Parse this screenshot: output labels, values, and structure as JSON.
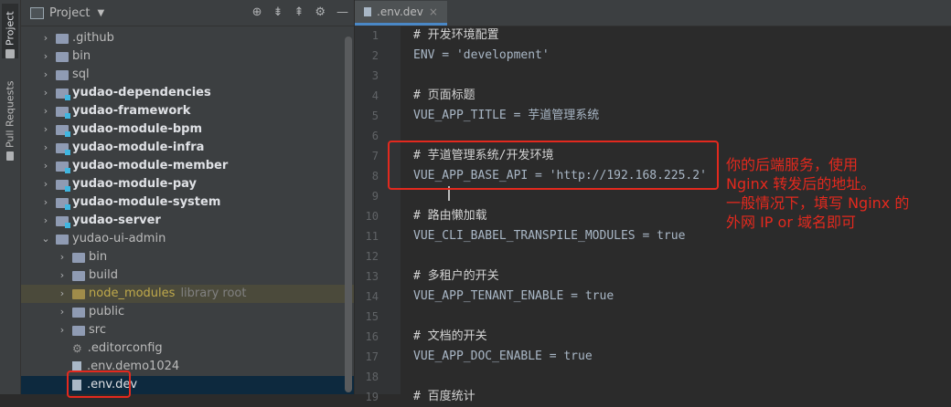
{
  "sidebar_tabs": {
    "project": "Project",
    "pull_requests": "Pull Requests"
  },
  "panel": {
    "title": "Project"
  },
  "tree": [
    {
      "label": ".github",
      "type": "folder",
      "indent": 0
    },
    {
      "label": "bin",
      "type": "folder",
      "indent": 0
    },
    {
      "label": "sql",
      "type": "folder",
      "indent": 0
    },
    {
      "label": "yudao-dependencies",
      "type": "module",
      "indent": 0
    },
    {
      "label": "yudao-framework",
      "type": "module",
      "indent": 0
    },
    {
      "label": "yudao-module-bpm",
      "type": "module",
      "indent": 0
    },
    {
      "label": "yudao-module-infra",
      "type": "module",
      "indent": 0
    },
    {
      "label": "yudao-module-member",
      "type": "module",
      "indent": 0
    },
    {
      "label": "yudao-module-pay",
      "type": "module",
      "indent": 0
    },
    {
      "label": "yudao-module-system",
      "type": "module",
      "indent": 0
    },
    {
      "label": "yudao-server",
      "type": "module",
      "indent": 0
    },
    {
      "label": "yudao-ui-admin",
      "type": "folder-open",
      "indent": 0
    },
    {
      "label": "bin",
      "type": "folder",
      "indent": 1
    },
    {
      "label": "build",
      "type": "folder",
      "indent": 1
    },
    {
      "label": "node_modules",
      "suffix": "library root",
      "type": "excluded",
      "indent": 1
    },
    {
      "label": "public",
      "type": "folder",
      "indent": 1
    },
    {
      "label": "src",
      "type": "folder",
      "indent": 1
    },
    {
      "label": ".editorconfig",
      "type": "config",
      "indent": 1
    },
    {
      "label": ".env.demo1024",
      "type": "file",
      "indent": 1
    },
    {
      "label": ".env.dev",
      "type": "file-selected",
      "indent": 1
    }
  ],
  "editor_tab": {
    "label": ".env.dev"
  },
  "code_lines": [
    {
      "n": "1",
      "text": "# 开发环境配置",
      "comment": true
    },
    {
      "n": "2",
      "text": "ENV = 'development'"
    },
    {
      "n": "3",
      "text": ""
    },
    {
      "n": "4",
      "text": "# 页面标题",
      "comment": true
    },
    {
      "n": "5",
      "text": "VUE_APP_TITLE = 芋道管理系统"
    },
    {
      "n": "6",
      "text": ""
    },
    {
      "n": "7",
      "text": "# 芋道管理系统/开发环境",
      "comment": true
    },
    {
      "n": "8",
      "text": "VUE_APP_BASE_API = 'http://192.168.225.2'"
    },
    {
      "n": "9",
      "text": ""
    },
    {
      "n": "10",
      "text": "# 路由懒加载",
      "comment": true
    },
    {
      "n": "11",
      "text": "VUE_CLI_BABEL_TRANSPILE_MODULES = true"
    },
    {
      "n": "12",
      "text": ""
    },
    {
      "n": "13",
      "text": "# 多租户的开关",
      "comment": true
    },
    {
      "n": "14",
      "text": "VUE_APP_TENANT_ENABLE = true"
    },
    {
      "n": "15",
      "text": ""
    },
    {
      "n": "16",
      "text": "# 文档的开关",
      "comment": true
    },
    {
      "n": "17",
      "text": "VUE_APP_DOC_ENABLE = true"
    },
    {
      "n": "18",
      "text": ""
    },
    {
      "n": "19",
      "text": "# 百度统计",
      "comment": true
    }
  ],
  "annotation": [
    "你的后端服务，使用",
    "Nginx 转发后的地址。",
    "一般情况下，填写 Nginx 的",
    "外网 IP or 域名即可"
  ],
  "colors": {
    "accent": "#4a88c7",
    "highlight_box": "#e3291e"
  }
}
